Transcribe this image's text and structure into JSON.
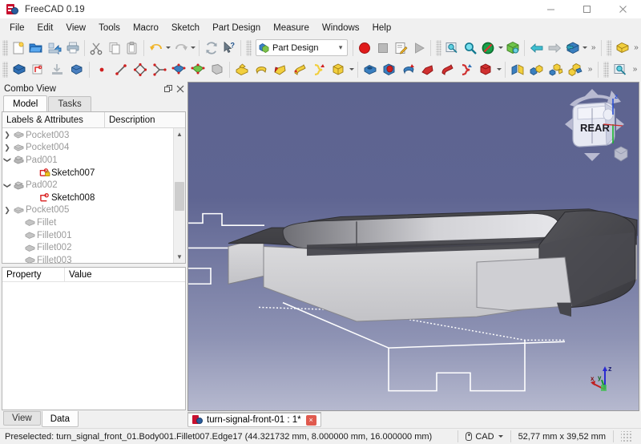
{
  "window": {
    "title": "FreeCAD 0.19",
    "app_icon": "freecad-logo-icon",
    "minimize_label": "Minimize",
    "maximize_label": "Maximize",
    "close_label": "Close"
  },
  "menubar": {
    "items": [
      {
        "label": "File"
      },
      {
        "label": "Edit"
      },
      {
        "label": "View"
      },
      {
        "label": "Tools"
      },
      {
        "label": "Macro"
      },
      {
        "label": "Sketch"
      },
      {
        "label": "Part Design"
      },
      {
        "label": "Measure"
      },
      {
        "label": "Windows"
      },
      {
        "label": "Help"
      }
    ]
  },
  "toolbars": {
    "workbench_selector": {
      "value": "Part Design",
      "icon": "part-design-workbench-icon"
    },
    "row1": [
      {
        "name": "new-document-button",
        "icon": "new-document-icon"
      },
      {
        "name": "open-document-button",
        "icon": "open-folder-icon"
      },
      {
        "name": "save-document-button",
        "icon": "save-icon"
      },
      {
        "name": "print-button",
        "icon": "printer-icon"
      },
      {
        "name": "cut-button",
        "icon": "scissors-icon"
      },
      {
        "name": "copy-button",
        "icon": "copy-icon"
      },
      {
        "name": "paste-button",
        "icon": "clipboard-icon"
      },
      {
        "name": "undo-button",
        "icon": "undo-arrow-icon"
      },
      {
        "name": "redo-button",
        "icon": "redo-arrow-icon"
      },
      {
        "name": "refresh-button",
        "icon": "refresh-icon"
      },
      {
        "name": "whats-this-button",
        "icon": "cursor-question-icon"
      },
      {
        "name": "macro-record-button",
        "icon": "record-circle-icon"
      },
      {
        "name": "macro-stop-button",
        "icon": "stop-square-icon"
      },
      {
        "name": "macro-edit-button",
        "icon": "macro-edit-icon"
      },
      {
        "name": "macro-execute-button",
        "icon": "play-triangle-icon"
      },
      {
        "name": "fit-selection-button",
        "icon": "fit-selection-icon"
      },
      {
        "name": "fit-all-button",
        "icon": "magnifier-icon"
      },
      {
        "name": "draw-style-button",
        "icon": "no-entry-icon"
      },
      {
        "name": "axonometric-view-button",
        "icon": "isometric-cube-icon"
      },
      {
        "name": "previous-view-button",
        "icon": "arrow-left-icon"
      },
      {
        "name": "next-view-button",
        "icon": "arrow-right-icon"
      },
      {
        "name": "std-views-button",
        "icon": "view-cube-icon"
      },
      {
        "name": "part-shape-button",
        "icon": "yellow-shape-icon"
      }
    ],
    "row2": [
      {
        "name": "create-body-button",
        "icon": "body-icon"
      },
      {
        "name": "create-sketch-button",
        "icon": "sketch-icon"
      },
      {
        "name": "attach-sketch-button",
        "icon": "attach-sketch-icon"
      },
      {
        "name": "validate-sketch-button",
        "icon": "validate-sketch-icon"
      },
      {
        "name": "point-button",
        "icon": "point-icon"
      },
      {
        "name": "line-button",
        "icon": "line-icon"
      },
      {
        "name": "polyline-button",
        "icon": "polyline-icon"
      },
      {
        "name": "datum-line-button",
        "icon": "datum-line-icon"
      },
      {
        "name": "datum-plane-button",
        "icon": "datum-plane-icon"
      },
      {
        "name": "datum-point-button",
        "icon": "datum-point-icon"
      },
      {
        "name": "shapebinder-button",
        "icon": "shapebinder-icon"
      },
      {
        "name": "pad-button",
        "icon": "pad-icon"
      },
      {
        "name": "revolution-button",
        "icon": "revolution-icon"
      },
      {
        "name": "additive-loft-button",
        "icon": "additive-loft-icon"
      },
      {
        "name": "additive-pipe-button",
        "icon": "additive-pipe-icon"
      },
      {
        "name": "additive-helix-button",
        "icon": "additive-helix-icon"
      },
      {
        "name": "additive-box-button",
        "icon": "additive-box-icon"
      },
      {
        "name": "pocket-button",
        "icon": "pocket-icon"
      },
      {
        "name": "hole-button",
        "icon": "hole-icon"
      },
      {
        "name": "groove-button",
        "icon": "groove-icon"
      },
      {
        "name": "subtractive-loft-button",
        "icon": "subtractive-loft-icon"
      },
      {
        "name": "subtractive-pipe-button",
        "icon": "subtractive-pipe-icon"
      },
      {
        "name": "subtractive-helix-button",
        "icon": "subtractive-helix-icon"
      },
      {
        "name": "subtractive-box-button",
        "icon": "subtractive-box-icon"
      },
      {
        "name": "mirrored-button",
        "icon": "mirrored-icon"
      },
      {
        "name": "linear-pattern-button",
        "icon": "linear-pattern-icon"
      },
      {
        "name": "polar-pattern-button",
        "icon": "polar-pattern-icon"
      },
      {
        "name": "multitransform-button",
        "icon": "multitransform-icon"
      },
      {
        "name": "measure-button",
        "icon": "measure-icon"
      }
    ]
  },
  "combo_view": {
    "title": "Combo View",
    "float_label": "Float",
    "close_label": "Close",
    "tabs": [
      {
        "label": "Model",
        "active": true
      },
      {
        "label": "Tasks",
        "active": false
      }
    ],
    "tree": {
      "columns": [
        "Labels & Attributes",
        "Description"
      ],
      "items": [
        {
          "label": "Pocket003",
          "icon": "pocket-feature-icon",
          "expander": "collapsed",
          "depth": 1,
          "active": false
        },
        {
          "label": "Pocket004",
          "icon": "pocket-feature-icon",
          "expander": "collapsed",
          "depth": 1,
          "active": false
        },
        {
          "label": "Pad001",
          "icon": "pad-feature-icon",
          "expander": "expanded",
          "depth": 1,
          "active": false
        },
        {
          "label": "Sketch007",
          "icon": "sketch-mapped-icon",
          "expander": "none",
          "depth": 2,
          "active": true
        },
        {
          "label": "Pad002",
          "icon": "pad-feature-icon",
          "expander": "expanded",
          "depth": 1,
          "active": false
        },
        {
          "label": "Sketch008",
          "icon": "sketch-icon",
          "expander": "none",
          "depth": 2,
          "active": true
        },
        {
          "label": "Pocket005",
          "icon": "pocket-feature-icon",
          "expander": "collapsed",
          "depth": 1,
          "active": false
        },
        {
          "label": "Fillet",
          "icon": "fillet-feature-icon",
          "expander": "none",
          "depth": 1,
          "active": false
        },
        {
          "label": "Fillet001",
          "icon": "fillet-feature-icon",
          "expander": "none",
          "depth": 1,
          "active": false
        },
        {
          "label": "Fillet002",
          "icon": "fillet-feature-icon",
          "expander": "none",
          "depth": 1,
          "active": false
        },
        {
          "label": "Fillet003",
          "icon": "fillet-feature-icon",
          "expander": "none",
          "depth": 1,
          "active": false
        }
      ]
    },
    "property_editor": {
      "columns": [
        "Property",
        "Value"
      ],
      "rows": []
    },
    "bottom_tabs": [
      {
        "label": "View",
        "active": false
      },
      {
        "label": "Data",
        "active": true
      }
    ]
  },
  "view3d": {
    "navigation_cube_face": "REAR",
    "axis_labels": {
      "x": "x",
      "y": "y",
      "z": "z"
    },
    "document_tab": {
      "label": "turn-signal-front-01 : 1*",
      "icon": "freecad-document-icon",
      "close_label": "×"
    }
  },
  "statusbar": {
    "message": "Preselected: turn_signal_front_01.Body001.Fillet007.Edge17 (44.321732 mm, 8.000000 mm, 16.000000 mm)",
    "navigation_style": "CAD",
    "navigation_icon": "mouse-icon",
    "dimensions": "52,77 mm x 39,52 mm"
  }
}
